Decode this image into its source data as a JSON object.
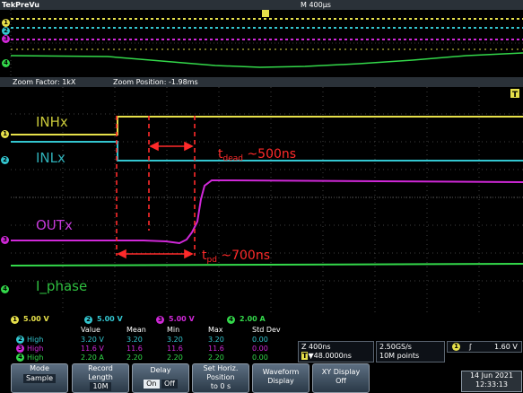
{
  "header": {
    "brand": "Tek",
    "mode": "PreVu",
    "timebase": "M 400µs",
    "trigger_marker": "T"
  },
  "zoom": {
    "factor": "Zoom Factor: 1kX",
    "position": "Zoom Position: -1.98ms"
  },
  "traces": {
    "labels": {
      "inh": "INHx",
      "inl": "INLx",
      "out": "OUTx",
      "phase": "I_phase"
    },
    "markers": [
      "1",
      "2",
      "3",
      "4"
    ],
    "colors": {
      "ch1": "#e6e04a",
      "ch2": "#33c6d0",
      "ch3": "#d028d8",
      "ch4": "#33d84a"
    }
  },
  "annotations": {
    "tdead_prefix": "t",
    "tdead_sub": "dead",
    "tdead_value": " ~500ns",
    "tpd_prefix": "t",
    "tpd_sub": "pd",
    "tpd_value": " ~700ns",
    "color": "#ff2a2a"
  },
  "scales": [
    {
      "num": "1",
      "value": "5.00 V"
    },
    {
      "num": "2",
      "value": "5.00 V"
    },
    {
      "num": "3",
      "value": "5.00 V"
    },
    {
      "num": "4",
      "value": "2.00 A"
    }
  ],
  "measurements": {
    "headers": [
      "Value",
      "Mean",
      "Min",
      "Max",
      "Std Dev"
    ],
    "rows": [
      {
        "ch": "2",
        "name": "High",
        "values": [
          "3.20 V",
          "3.20",
          "3.20",
          "3.20",
          "0.00"
        ]
      },
      {
        "ch": "3",
        "name": "High",
        "values": [
          "11.6 V",
          "11.6",
          "11.6",
          "11.6",
          "0.00"
        ]
      },
      {
        "ch": "4",
        "name": "High",
        "values": [
          "2.20 A",
          "2.20",
          "2.20",
          "2.20",
          "0.00"
        ]
      }
    ]
  },
  "horizontal": {
    "scale": "Z 400ns",
    "position": "▼48.0000ns",
    "t_marker": "T"
  },
  "acquisition": {
    "rate": "2.50GS/s",
    "points": "10M points"
  },
  "trigger": {
    "channel": "1",
    "slope": "ʃ",
    "level": "1.60 V"
  },
  "buttons": {
    "mode_label": "Mode",
    "mode_value": "Sample",
    "record_label1": "Record",
    "record_label2": "Length",
    "record_value": "10M",
    "delay_label": "Delay",
    "delay_on": "On",
    "delay_off": "Off",
    "sethoriz_label1": "Set Horiz.",
    "sethoriz_label2": "Position",
    "sethoriz_label3": "to 0 s",
    "waveform_label1": "Waveform",
    "waveform_label2": "Display",
    "xy_label1": "XY Display",
    "xy_value": "Off"
  },
  "datetime": {
    "date": "14 Jun 2021",
    "time": "12:33:13"
  }
}
